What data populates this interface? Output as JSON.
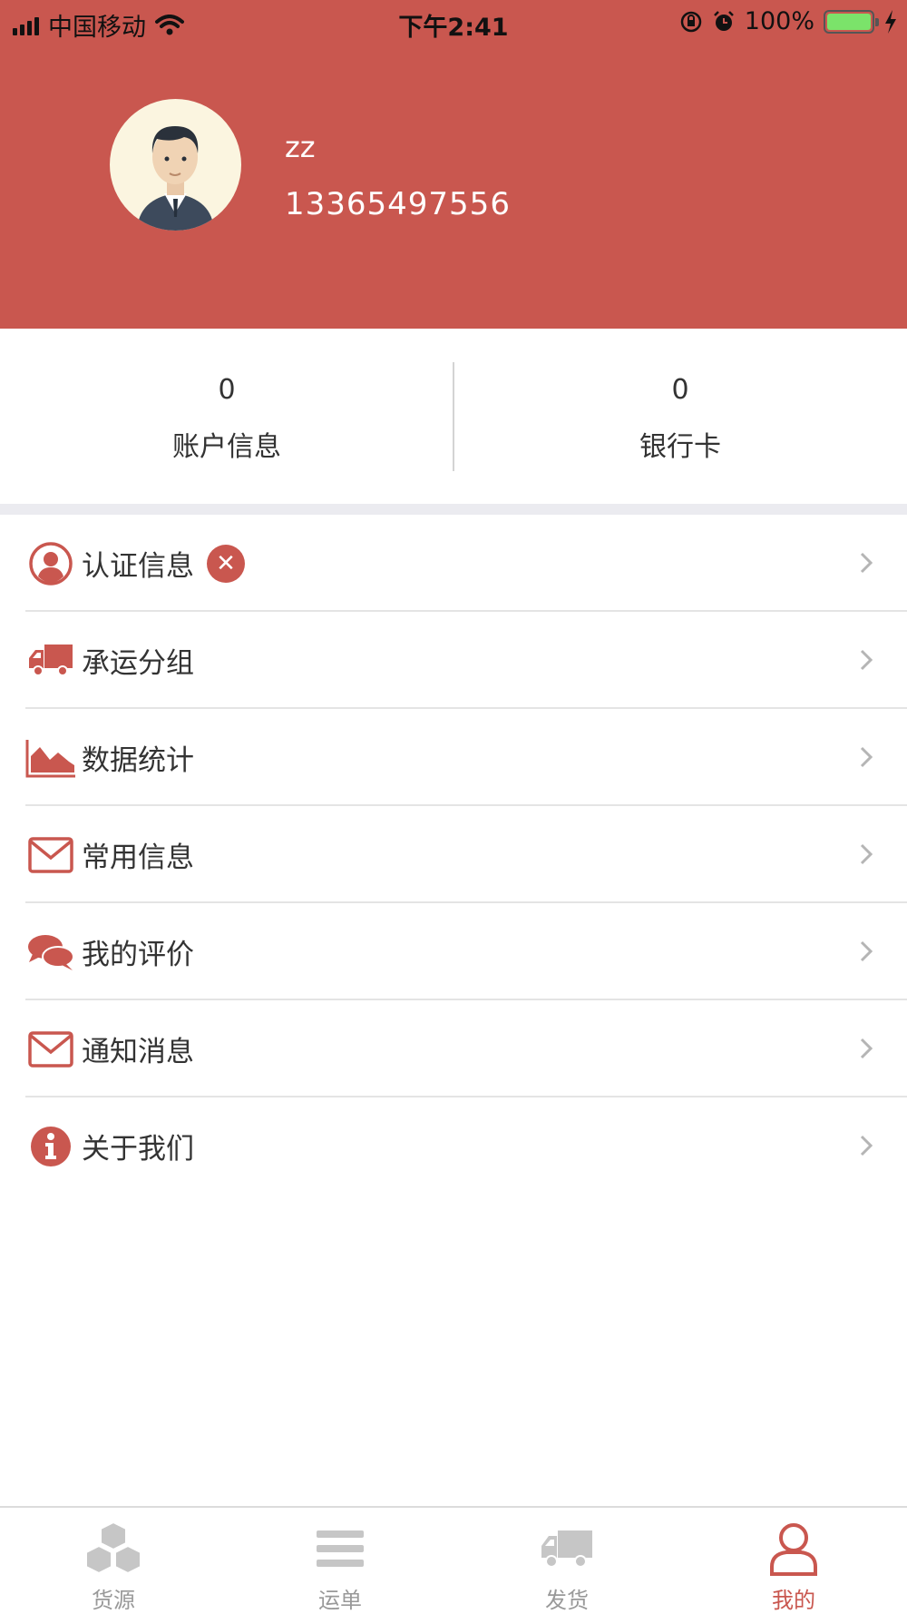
{
  "status_bar": {
    "carrier": "中国移动",
    "time": "下午2:41",
    "battery_percent": "100%"
  },
  "profile": {
    "name": "zz",
    "phone": "13365497556"
  },
  "stats": [
    {
      "value": "0",
      "label": "账户信息"
    },
    {
      "value": "0",
      "label": "银行卡"
    }
  ],
  "menu": [
    {
      "label": "认证信息",
      "icon": "user-circle-icon",
      "status_icon": "error-x-icon"
    },
    {
      "label": "承运分组",
      "icon": "truck-icon"
    },
    {
      "label": "数据统计",
      "icon": "area-chart-icon"
    },
    {
      "label": "常用信息",
      "icon": "envelope-icon"
    },
    {
      "label": "我的评价",
      "icon": "chat-bubbles-icon"
    },
    {
      "label": "通知消息",
      "icon": "envelope-icon"
    },
    {
      "label": "关于我们",
      "icon": "info-icon"
    }
  ],
  "tabbar": [
    {
      "label": "货源",
      "icon": "cubes-icon",
      "active": false
    },
    {
      "label": "运单",
      "icon": "list-icon",
      "active": false
    },
    {
      "label": "发货",
      "icon": "truck-icon",
      "active": false
    },
    {
      "label": "我的",
      "icon": "person-icon",
      "active": true
    }
  ],
  "colors": {
    "brand": "#c9574f",
    "tab_inactive": "#999999",
    "section_gap": "#ebebf0"
  }
}
